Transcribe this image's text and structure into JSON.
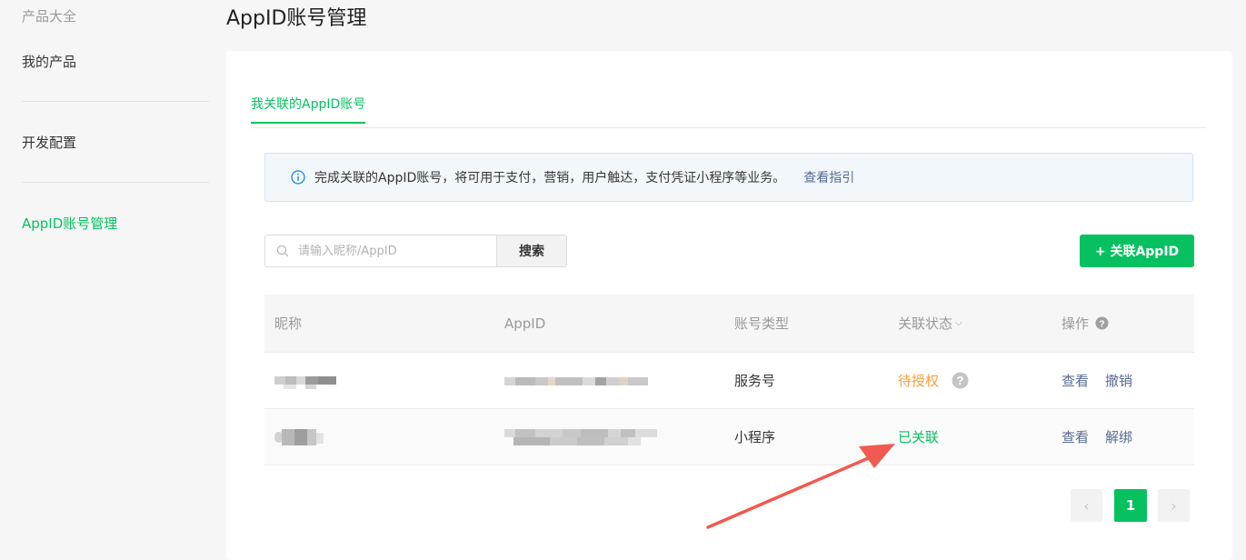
{
  "sidebar": {
    "section_title": "产品大全",
    "items": [
      {
        "label": "我的产品"
      },
      {
        "label": "开发配置"
      },
      {
        "label": "AppID账号管理"
      }
    ]
  },
  "header": {
    "title": "AppID账号管理"
  },
  "tabs": [
    {
      "label": "我关联的AppID账号",
      "active": true
    }
  ],
  "notice": {
    "text": "完成关联的AppID账号，将可用于支付，营销，用户触达，支付凭证小程序等业务。",
    "link": "查看指引",
    "icon": "info-icon"
  },
  "search": {
    "placeholder": "请输入昵称/AppID",
    "button": "搜索"
  },
  "add_button": "+ 关联AppID",
  "table": {
    "headers": {
      "nickname": "昵称",
      "appid": "AppID",
      "type": "账号类型",
      "status": "关联状态",
      "actions": "操作"
    },
    "rows": [
      {
        "nickname": "",
        "appid": "",
        "type": "服务号",
        "status": "待授权",
        "status_color": "#fa9d3b",
        "actions": [
          "查看",
          "撤销"
        ]
      },
      {
        "nickname": "",
        "appid": "",
        "type": "小程序",
        "status": "已关联",
        "status_color": "#07c160",
        "actions": [
          "查看",
          "解绑"
        ]
      }
    ]
  },
  "pagination": {
    "current": "1",
    "prev": "‹",
    "next": "›"
  },
  "colors": {
    "accent": "#07c160",
    "link": "#576b95",
    "pending": "#fa9d3b",
    "annotation_arrow": "#f05a50"
  }
}
